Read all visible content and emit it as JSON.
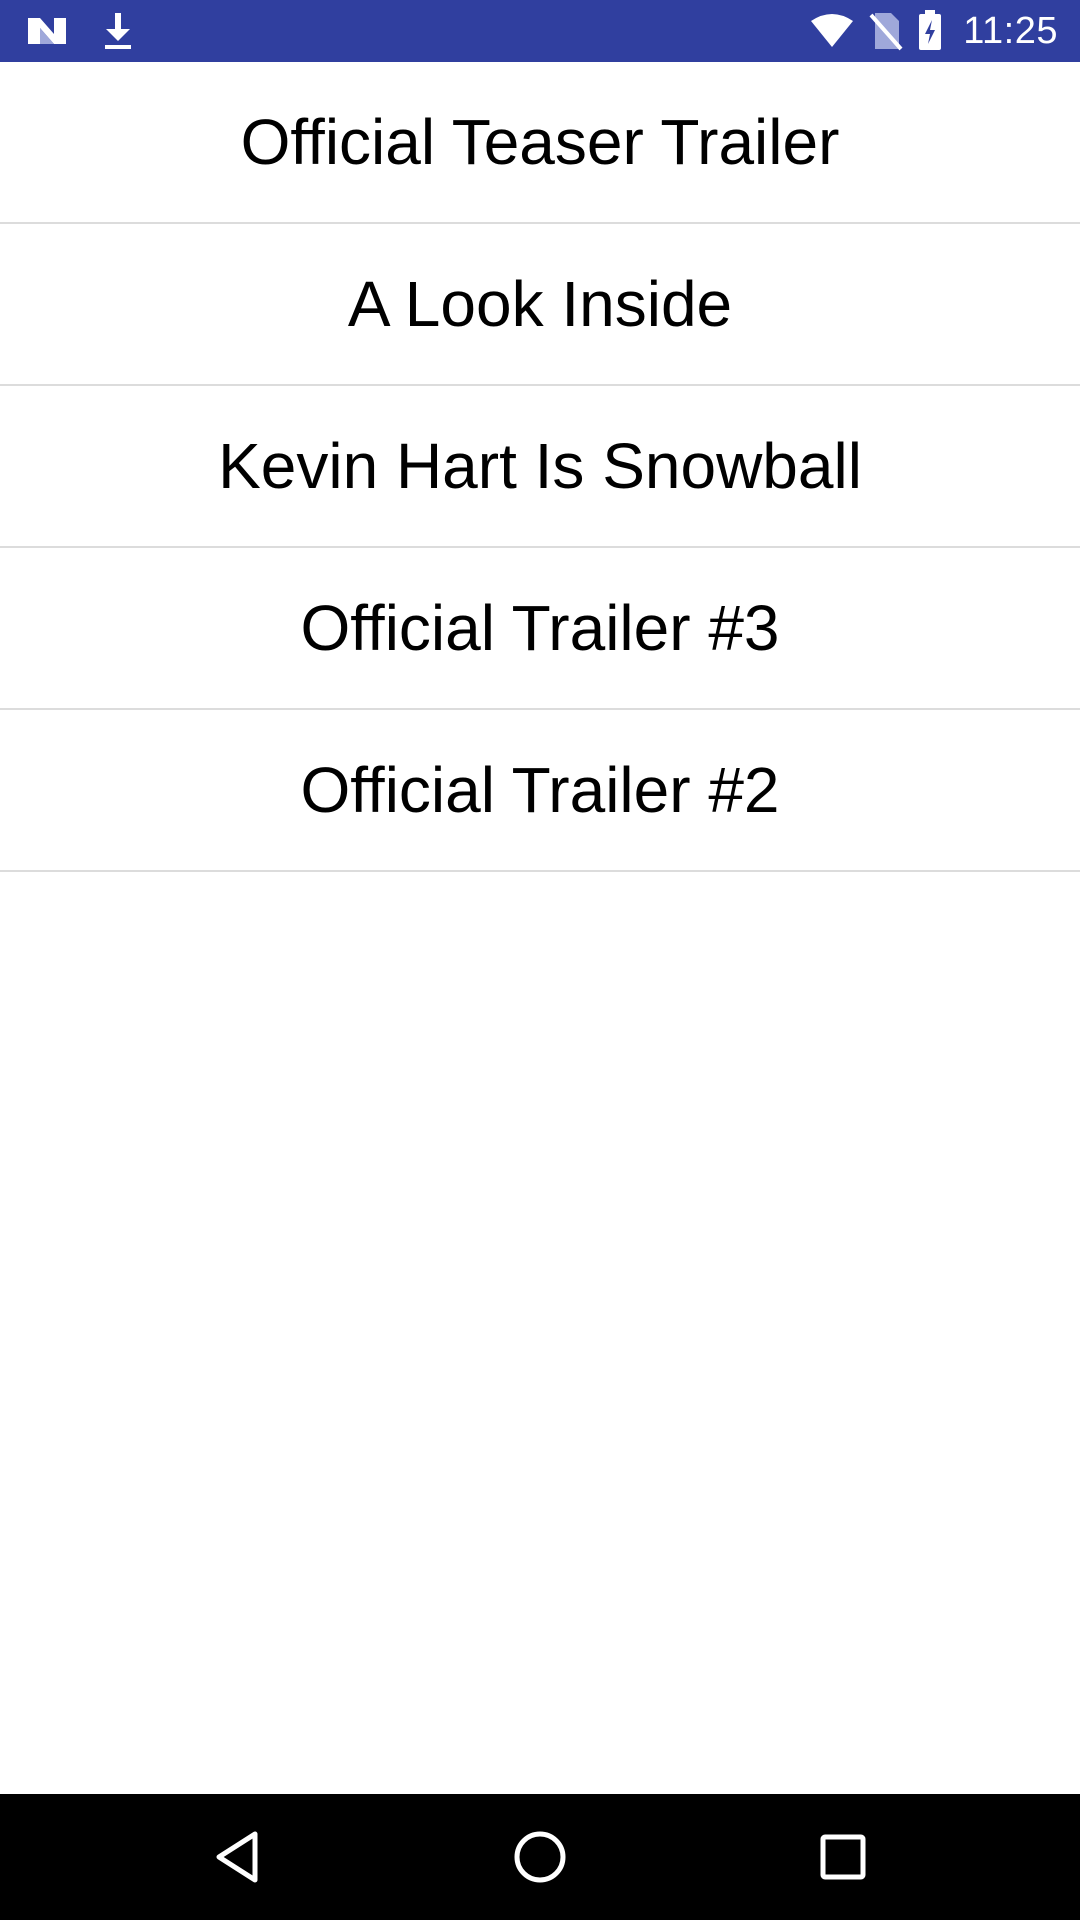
{
  "status_bar": {
    "time": "11:25",
    "background_color": "#303F9F",
    "left_icons": [
      "n-notification-icon",
      "download-icon"
    ],
    "right_icons": [
      "wifi-icon",
      "no-sim-icon",
      "battery-charging-icon"
    ]
  },
  "list": {
    "items": [
      {
        "label": "Official Teaser Trailer"
      },
      {
        "label": "A Look Inside"
      },
      {
        "label": "Kevin Hart Is Snowball"
      },
      {
        "label": "Official Trailer #3"
      },
      {
        "label": "Official Trailer #2"
      }
    ]
  },
  "nav_bar": {
    "buttons": [
      "back-icon",
      "home-icon",
      "recents-icon"
    ]
  }
}
